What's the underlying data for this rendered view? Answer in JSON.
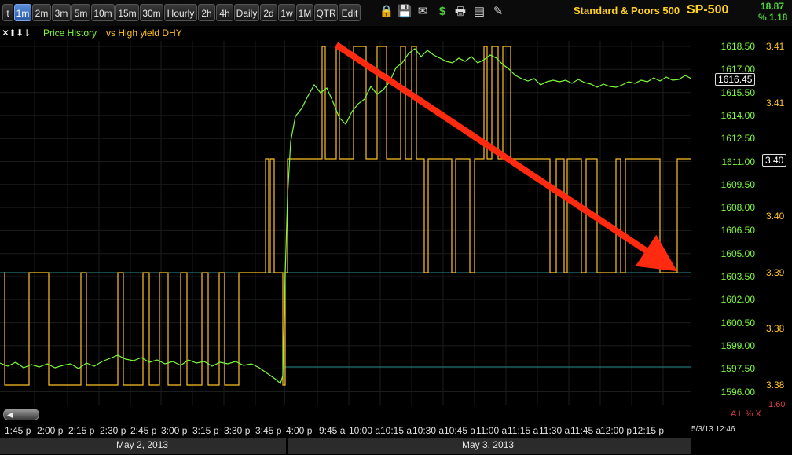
{
  "toolbar": {
    "tabs": [
      "t",
      "1m",
      "2m",
      "3m",
      "5m",
      "10m",
      "15m",
      "30m",
      "Hourly",
      "2h",
      "4h",
      "Daily",
      "2d",
      "1w",
      "1M",
      "QTR",
      "Edit"
    ],
    "active_tab": "1m",
    "icons": [
      "lock-icon",
      "save-icon",
      "mail-icon",
      "dollar-icon",
      "print-icon",
      "chart-settings-icon",
      "pencil-icon"
    ]
  },
  "header": {
    "instrument_name": "Standard & Poors 500",
    "symbol": "SP-500",
    "change": "18.87",
    "change_pct": "% 1.18"
  },
  "legend": {
    "arrows": "✕⬆⬇⇂",
    "price_label": "Price History",
    "comparison_label": "vs High yield DHY"
  },
  "chart_data": {
    "type": "line",
    "series": [
      {
        "name": "Price History",
        "axis": "left",
        "color": "#7cfc3a"
      },
      {
        "name": "vs High yield DHY",
        "axis": "right",
        "color": "#ffc125"
      }
    ],
    "left_axis": {
      "ticks": [
        "1618.50",
        "1617.00",
        "1615.50",
        "1614.00",
        "1612.50",
        "1611.00",
        "1609.50",
        "1608.00",
        "1606.50",
        "1605.00",
        "1603.50",
        "1602.00",
        "1600.50",
        "1599.00",
        "1597.50",
        "1596.00"
      ],
      "last_value": "1616.45"
    },
    "right_axis": {
      "ticks": [
        "3.41",
        "3.41",
        "3.40",
        "3.40",
        "3.39",
        "3.38",
        "3.38"
      ],
      "last_value": "3.40"
    },
    "indicator": {
      "value": "1.60",
      "label": "A L % X"
    },
    "x_ticks": [
      "1:45 p",
      "2:00 p",
      "2:15 p",
      "2:30 p",
      "2:45 p",
      "3:00 p",
      "3:15 p",
      "3:30 p",
      "3:45 p",
      "4:00 p",
      "9:45 a",
      "10:00 a",
      "10:15 a",
      "10:30 a",
      "10:45 a",
      "11:00 a",
      "11:15 a",
      "11:30 a",
      "11:45 a",
      "12:00 p",
      "12:15 p"
    ],
    "timestamp": "5/3/13 12:46",
    "dates": [
      "May 2, 2013",
      "May 3, 2013"
    ],
    "annotation": {
      "type": "arrow",
      "color": "#ff2a10",
      "meaning": "downtrend"
    }
  }
}
